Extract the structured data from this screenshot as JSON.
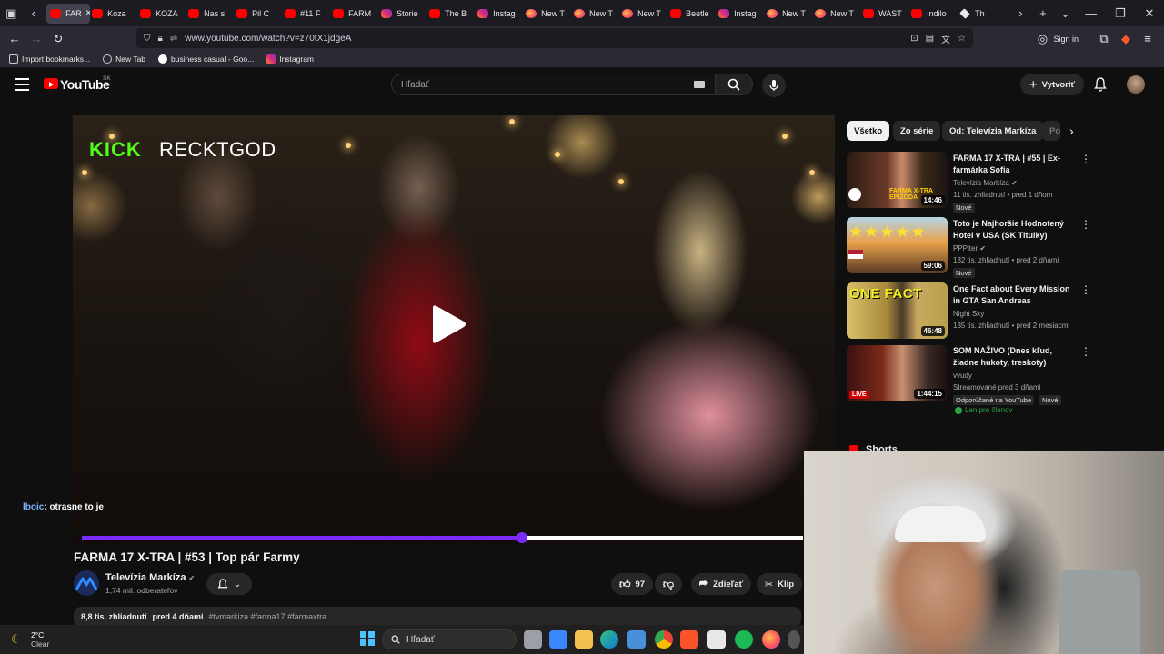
{
  "browser": {
    "tabs": [
      {
        "label": "FAR",
        "favicon": "youtube",
        "active": true
      },
      {
        "label": "Koza",
        "favicon": "youtube"
      },
      {
        "label": "KOZA",
        "favicon": "youtube"
      },
      {
        "label": "Nas s",
        "favicon": "youtube"
      },
      {
        "label": "Pil C",
        "favicon": "youtube"
      },
      {
        "label": "#11 F",
        "favicon": "youtube"
      },
      {
        "label": "FARM",
        "favicon": "youtube"
      },
      {
        "label": "Storie",
        "favicon": "instagram"
      },
      {
        "label": "The B",
        "favicon": "youtube"
      },
      {
        "label": "Instag",
        "favicon": "instagram"
      },
      {
        "label": "New T",
        "favicon": "firefox"
      },
      {
        "label": "New T",
        "favicon": "firefox"
      },
      {
        "label": "New T",
        "favicon": "firefox"
      },
      {
        "label": "Beetle",
        "favicon": "youtube"
      },
      {
        "label": "Instag",
        "favicon": "instagram"
      },
      {
        "label": "New T",
        "favicon": "firefox"
      },
      {
        "label": "New T",
        "favicon": "firefox"
      },
      {
        "label": "WAST",
        "favicon": "youtube"
      },
      {
        "label": "Indilo",
        "favicon": "youtube"
      },
      {
        "label": "Th",
        "favicon": "white"
      }
    ],
    "url": "www.youtube.com/watch?v=z70tX1jdgeA",
    "sign_in": "Sign in",
    "bookmarks": [
      {
        "label": "Import bookmarks...",
        "icon": "import-icon"
      },
      {
        "label": "New Tab",
        "icon": "globe-icon"
      },
      {
        "label": "business casual - Goo...",
        "icon": "google-icon"
      },
      {
        "label": "Instagram",
        "icon": "instagram-icon"
      }
    ]
  },
  "youtube": {
    "logo": "YouTube",
    "region": "SK",
    "search_placeholder": "Hľadať",
    "create_label": "Vytvoriť",
    "video": {
      "overlay_brand": "KICK",
      "overlay_channel": "RECKTGOD",
      "chat_user": "lboic",
      "chat_message": ": otrasne to je",
      "progress": 0.61,
      "title": "FARMA 17 X-TRA | #53 | Top pár Farmy",
      "channel": "Televízia Markíza",
      "subscribers": "1,74 mil. odberateľov",
      "likes": "97",
      "share_label": "Zdieľať",
      "clip_label": "Klip",
      "views": "8,8 tis. zhliadnutí",
      "date": "pred 4 dňami",
      "tags": "#tvmarkiza #farma17 #farmaxtra"
    },
    "chips": [
      {
        "label": "Všetko",
        "active": true
      },
      {
        "label": "Zo série"
      },
      {
        "label": "Od: Televízia Markíza"
      },
      {
        "label": "Po"
      }
    ],
    "related": [
      {
        "title": "FARMA 17 X-TRA | #55 | Ex-farmárka Sofia",
        "channel": "Televízia Markíza",
        "meta": "11 tis. zhliadnutí • pred 1 dňom",
        "badges": [
          "Nové"
        ],
        "duration": "14:46",
        "thumb_label": "FARMA X-TRA EPIZÓDA"
      },
      {
        "title": "Toto je Najhoršie Hodnotený Hotel v USA (SK Titulky)",
        "channel": "PPPiter",
        "meta": "132 tis. zhliadnutí • pred 2 dňami",
        "badges": [
          "Nové"
        ],
        "duration": "59:06",
        "thumb_label": ""
      },
      {
        "title": "One Fact about Every Mission in GTA San Andreas",
        "channel": "Night Sky",
        "meta": "135 tis. zhliadnutí • pred 2 mesiacmi",
        "badges": [],
        "duration": "46:48",
        "thumb_label": "ONE FACT"
      },
      {
        "title": "SOM NAŽIVO (Dnes kľud, žiadne hukoty, treskoty)",
        "channel": "vvudy",
        "meta": "Streamované pred 3 dňami",
        "badges": [
          "Odporúčané na YouTube",
          "Nové"
        ],
        "extra": "Len pre členov",
        "duration": "1:44:15",
        "live": "LIVE",
        "thumb_label": ""
      }
    ],
    "shorts_label": "Shorts"
  },
  "taskbar": {
    "temperature": "2°C",
    "condition": "Clear",
    "search": "Hľadať"
  }
}
